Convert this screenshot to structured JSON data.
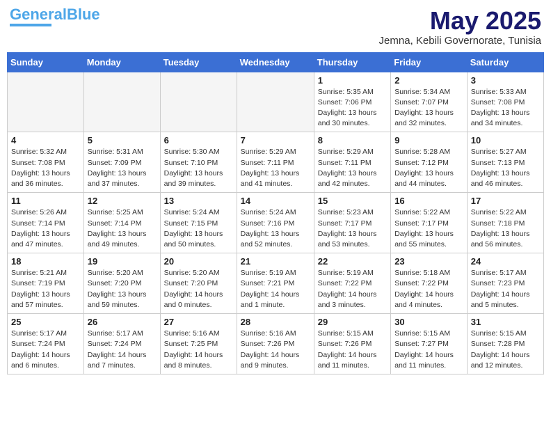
{
  "logo": {
    "general": "General",
    "blue": "Blue"
  },
  "header": {
    "month": "May 2025",
    "location": "Jemna, Kebili Governorate, Tunisia"
  },
  "days_of_week": [
    "Sunday",
    "Monday",
    "Tuesday",
    "Wednesday",
    "Thursday",
    "Friday",
    "Saturday"
  ],
  "weeks": [
    [
      {
        "day": "",
        "info": ""
      },
      {
        "day": "",
        "info": ""
      },
      {
        "day": "",
        "info": ""
      },
      {
        "day": "",
        "info": ""
      },
      {
        "day": "1",
        "info": "Sunrise: 5:35 AM\nSunset: 7:06 PM\nDaylight: 13 hours\nand 30 minutes."
      },
      {
        "day": "2",
        "info": "Sunrise: 5:34 AM\nSunset: 7:07 PM\nDaylight: 13 hours\nand 32 minutes."
      },
      {
        "day": "3",
        "info": "Sunrise: 5:33 AM\nSunset: 7:08 PM\nDaylight: 13 hours\nand 34 minutes."
      }
    ],
    [
      {
        "day": "4",
        "info": "Sunrise: 5:32 AM\nSunset: 7:08 PM\nDaylight: 13 hours\nand 36 minutes."
      },
      {
        "day": "5",
        "info": "Sunrise: 5:31 AM\nSunset: 7:09 PM\nDaylight: 13 hours\nand 37 minutes."
      },
      {
        "day": "6",
        "info": "Sunrise: 5:30 AM\nSunset: 7:10 PM\nDaylight: 13 hours\nand 39 minutes."
      },
      {
        "day": "7",
        "info": "Sunrise: 5:29 AM\nSunset: 7:11 PM\nDaylight: 13 hours\nand 41 minutes."
      },
      {
        "day": "8",
        "info": "Sunrise: 5:29 AM\nSunset: 7:11 PM\nDaylight: 13 hours\nand 42 minutes."
      },
      {
        "day": "9",
        "info": "Sunrise: 5:28 AM\nSunset: 7:12 PM\nDaylight: 13 hours\nand 44 minutes."
      },
      {
        "day": "10",
        "info": "Sunrise: 5:27 AM\nSunset: 7:13 PM\nDaylight: 13 hours\nand 46 minutes."
      }
    ],
    [
      {
        "day": "11",
        "info": "Sunrise: 5:26 AM\nSunset: 7:14 PM\nDaylight: 13 hours\nand 47 minutes."
      },
      {
        "day": "12",
        "info": "Sunrise: 5:25 AM\nSunset: 7:14 PM\nDaylight: 13 hours\nand 49 minutes."
      },
      {
        "day": "13",
        "info": "Sunrise: 5:24 AM\nSunset: 7:15 PM\nDaylight: 13 hours\nand 50 minutes."
      },
      {
        "day": "14",
        "info": "Sunrise: 5:24 AM\nSunset: 7:16 PM\nDaylight: 13 hours\nand 52 minutes."
      },
      {
        "day": "15",
        "info": "Sunrise: 5:23 AM\nSunset: 7:17 PM\nDaylight: 13 hours\nand 53 minutes."
      },
      {
        "day": "16",
        "info": "Sunrise: 5:22 AM\nSunset: 7:17 PM\nDaylight: 13 hours\nand 55 minutes."
      },
      {
        "day": "17",
        "info": "Sunrise: 5:22 AM\nSunset: 7:18 PM\nDaylight: 13 hours\nand 56 minutes."
      }
    ],
    [
      {
        "day": "18",
        "info": "Sunrise: 5:21 AM\nSunset: 7:19 PM\nDaylight: 13 hours\nand 57 minutes."
      },
      {
        "day": "19",
        "info": "Sunrise: 5:20 AM\nSunset: 7:20 PM\nDaylight: 13 hours\nand 59 minutes."
      },
      {
        "day": "20",
        "info": "Sunrise: 5:20 AM\nSunset: 7:20 PM\nDaylight: 14 hours\nand 0 minutes."
      },
      {
        "day": "21",
        "info": "Sunrise: 5:19 AM\nSunset: 7:21 PM\nDaylight: 14 hours\nand 1 minute."
      },
      {
        "day": "22",
        "info": "Sunrise: 5:19 AM\nSunset: 7:22 PM\nDaylight: 14 hours\nand 3 minutes."
      },
      {
        "day": "23",
        "info": "Sunrise: 5:18 AM\nSunset: 7:22 PM\nDaylight: 14 hours\nand 4 minutes."
      },
      {
        "day": "24",
        "info": "Sunrise: 5:17 AM\nSunset: 7:23 PM\nDaylight: 14 hours\nand 5 minutes."
      }
    ],
    [
      {
        "day": "25",
        "info": "Sunrise: 5:17 AM\nSunset: 7:24 PM\nDaylight: 14 hours\nand 6 minutes."
      },
      {
        "day": "26",
        "info": "Sunrise: 5:17 AM\nSunset: 7:24 PM\nDaylight: 14 hours\nand 7 minutes."
      },
      {
        "day": "27",
        "info": "Sunrise: 5:16 AM\nSunset: 7:25 PM\nDaylight: 14 hours\nand 8 minutes."
      },
      {
        "day": "28",
        "info": "Sunrise: 5:16 AM\nSunset: 7:26 PM\nDaylight: 14 hours\nand 9 minutes."
      },
      {
        "day": "29",
        "info": "Sunrise: 5:15 AM\nSunset: 7:26 PM\nDaylight: 14 hours\nand 11 minutes."
      },
      {
        "day": "30",
        "info": "Sunrise: 5:15 AM\nSunset: 7:27 PM\nDaylight: 14 hours\nand 11 minutes."
      },
      {
        "day": "31",
        "info": "Sunrise: 5:15 AM\nSunset: 7:28 PM\nDaylight: 14 hours\nand 12 minutes."
      }
    ]
  ]
}
